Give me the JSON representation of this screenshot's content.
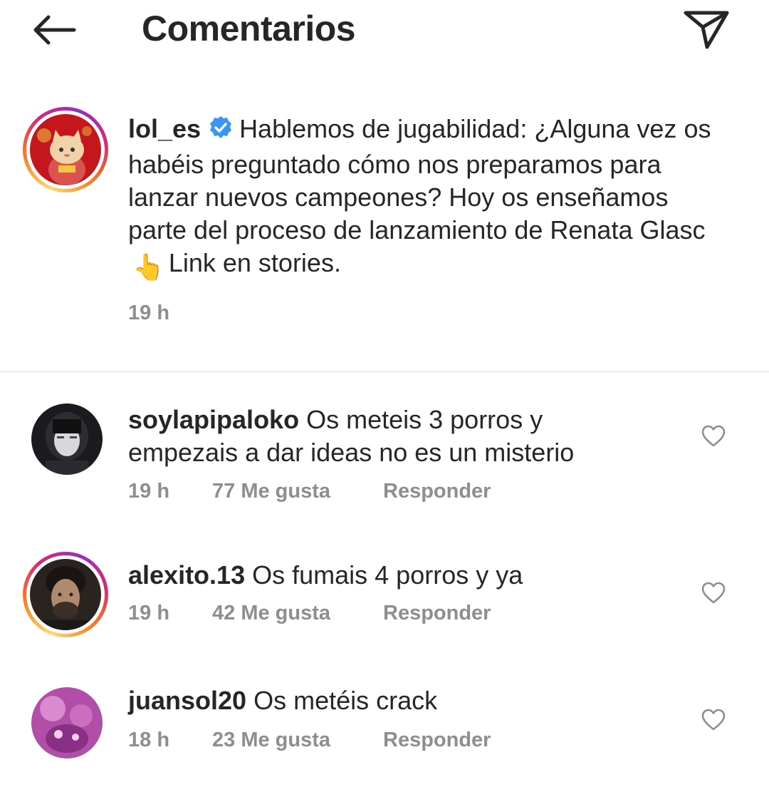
{
  "header": {
    "title": "Comentarios",
    "back_icon": "arrow-left-icon",
    "share_icon": "paper-plane-icon"
  },
  "caption": {
    "username": "lol_es",
    "verified": true,
    "text_before_emoji": "Hablemos de jugabilidad: ¿Alguna vez os habéis preguntado cómo nos preparamos para lanzar nuevos campeones? Hoy os enseñamos parte del proceso de lanzamiento de Renata Glasc",
    "emoji": "👆",
    "text_after_emoji": "Link en stories.",
    "time": "19 h"
  },
  "comments": [
    {
      "username": "soylapipaloko",
      "text": "Os meteis 3 porros y empezais a dar ideas no es un misterio",
      "time": "19 h",
      "likes": "77 Me gusta",
      "reply": "Responder"
    },
    {
      "username": "alexito.13",
      "text": "Os fumais 4 porros y ya",
      "time": "19 h",
      "likes": "42 Me gusta",
      "reply": "Responder"
    },
    {
      "username": "juansol20",
      "text": "Os metéis crack",
      "time": "18 h",
      "likes": "23 Me gusta",
      "reply": "Responder"
    }
  ],
  "colors": {
    "text": "#262626",
    "secondary": "#8e8e8e",
    "verified_blue": "#3897f0",
    "divider": "#dbdbdb"
  }
}
